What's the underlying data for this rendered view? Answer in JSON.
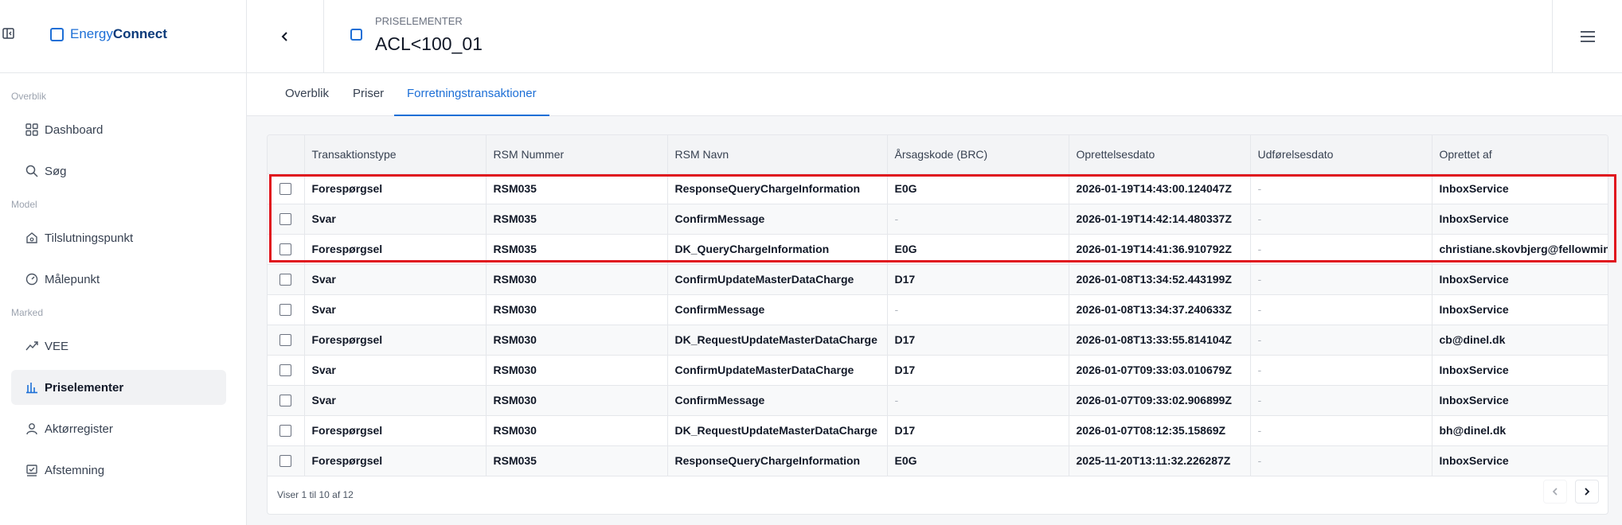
{
  "brand": {
    "part1": "Energy",
    "part2": "Connect"
  },
  "sidebar": {
    "sections": [
      {
        "label": "Overblik"
      },
      {
        "label": "Model"
      },
      {
        "label": "Marked"
      }
    ],
    "items": [
      {
        "label": "Dashboard",
        "icon": "grid-icon"
      },
      {
        "label": "Søg",
        "icon": "search-icon"
      },
      {
        "label": "Tilslutningspunkt",
        "icon": "house-icon"
      },
      {
        "label": "Målepunkt",
        "icon": "gauge-icon"
      },
      {
        "label": "VEE",
        "icon": "trend-icon"
      },
      {
        "label": "Priselementer",
        "icon": "bar-chart-icon",
        "active": true
      },
      {
        "label": "Aktørregister",
        "icon": "person-icon"
      },
      {
        "label": "Afstemning",
        "icon": "checklist-icon"
      }
    ]
  },
  "header": {
    "subtitle": "PRISELEMENTER",
    "title": "ACL<100_01"
  },
  "tabs": [
    {
      "label": "Overblik"
    },
    {
      "label": "Priser"
    },
    {
      "label": "Forretningstransaktioner",
      "active": true
    }
  ],
  "table": {
    "columns": [
      "Transaktionstype",
      "RSM Nummer",
      "RSM Navn",
      "Årsagskode (BRC)",
      "Oprettelsesdato",
      "Udførelsesdato",
      "Oprettet af"
    ],
    "rows": [
      {
        "type": "Forespørgsel",
        "rsm": "RSM035",
        "name": "ResponseQueryChargeInformation",
        "code": "E0G",
        "created": "2026-01-19T14:43:00.124047Z",
        "executed": "-",
        "by": "InboxService"
      },
      {
        "type": "Svar",
        "rsm": "RSM035",
        "name": "ConfirmMessage",
        "code": "-",
        "created": "2026-01-19T14:42:14.480337Z",
        "executed": "-",
        "by": "InboxService"
      },
      {
        "type": "Forespørgsel",
        "rsm": "RSM035",
        "name": "DK_QueryChargeInformation",
        "code": "E0G",
        "created": "2026-01-19T14:41:36.910792Z",
        "executed": "-",
        "by": "christiane.skovbjerg@fellowmind.c"
      },
      {
        "type": "Svar",
        "rsm": "RSM030",
        "name": "ConfirmUpdateMasterDataCharge",
        "code": "D17",
        "created": "2026-01-08T13:34:52.443199Z",
        "executed": "-",
        "by": "InboxService"
      },
      {
        "type": "Svar",
        "rsm": "RSM030",
        "name": "ConfirmMessage",
        "code": "-",
        "created": "2026-01-08T13:34:37.240633Z",
        "executed": "-",
        "by": "InboxService"
      },
      {
        "type": "Forespørgsel",
        "rsm": "RSM030",
        "name": "DK_RequestUpdateMasterDataCharge",
        "code": "D17",
        "created": "2026-01-08T13:33:55.814104Z",
        "executed": "-",
        "by": "cb@dinel.dk"
      },
      {
        "type": "Svar",
        "rsm": "RSM030",
        "name": "ConfirmUpdateMasterDataCharge",
        "code": "D17",
        "created": "2026-01-07T09:33:03.010679Z",
        "executed": "-",
        "by": "InboxService"
      },
      {
        "type": "Svar",
        "rsm": "RSM030",
        "name": "ConfirmMessage",
        "code": "-",
        "created": "2026-01-07T09:33:02.906899Z",
        "executed": "-",
        "by": "InboxService"
      },
      {
        "type": "Forespørgsel",
        "rsm": "RSM030",
        "name": "DK_RequestUpdateMasterDataCharge",
        "code": "D17",
        "created": "2026-01-07T08:12:35.15869Z",
        "executed": "-",
        "by": "bh@dinel.dk"
      },
      {
        "type": "Forespørgsel",
        "rsm": "RSM035",
        "name": "ResponseQueryChargeInformation",
        "code": "E0G",
        "created": "2025-11-20T13:11:32.226287Z",
        "executed": "-",
        "by": "InboxService"
      }
    ],
    "footer": "Viser 1 til 10 af 12"
  },
  "colors": {
    "accent": "#1d6fd6",
    "brand_dark": "#0b3a7a",
    "highlight": "#e0141e"
  }
}
